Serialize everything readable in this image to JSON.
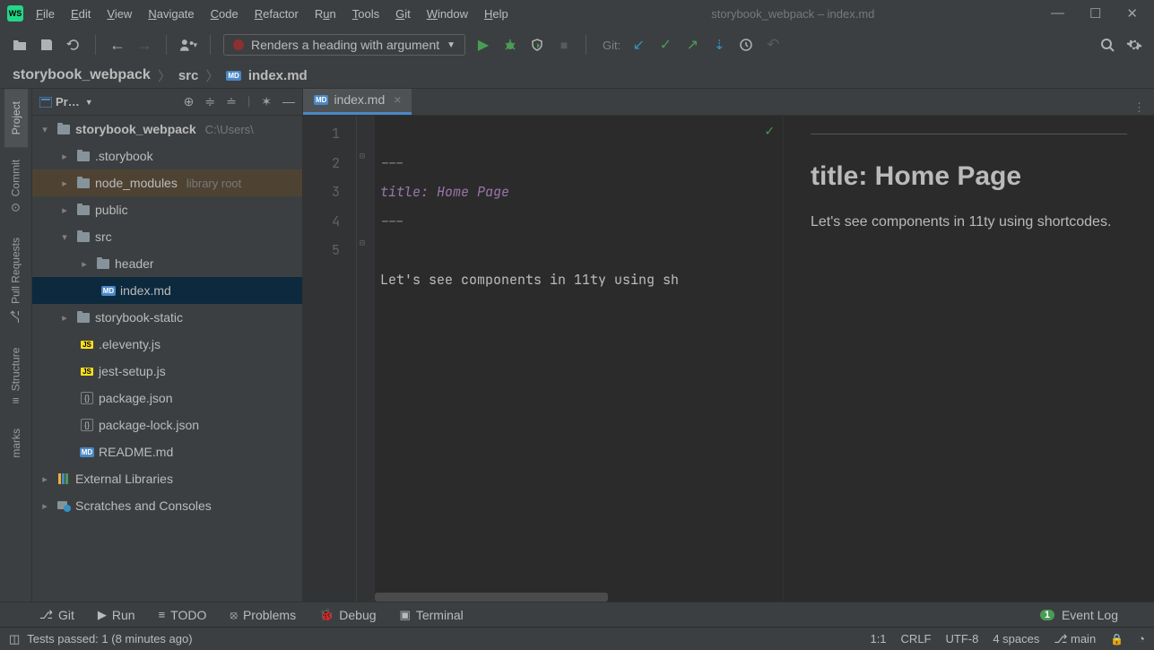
{
  "window": {
    "title": "storybook_webpack – index.md"
  },
  "menu": {
    "file": "File",
    "edit": "Edit",
    "view": "View",
    "navigate": "Navigate",
    "code": "Code",
    "refactor": "Refactor",
    "run": "Run",
    "tools": "Tools",
    "git": "Git",
    "window": "Window",
    "help": "Help"
  },
  "toolbar": {
    "run_config": "Renders a heading with argument",
    "git_label": "Git:"
  },
  "breadcrumb": {
    "project": "storybook_webpack",
    "folder": "src",
    "file": "index.md"
  },
  "sidebarTitle": "Pr…",
  "tree": {
    "root": "storybook_webpack",
    "rootPath": "C:\\Users\\",
    "storybook": ".storybook",
    "node_modules": "node_modules",
    "node_modules_tag": "library root",
    "public": "public",
    "src": "src",
    "header": "header",
    "index_md": "index.md",
    "storybook_static": "storybook-static",
    "eleventy": ".eleventy.js",
    "jest_setup": "jest-setup.js",
    "package": "package.json",
    "package_lock": "package-lock.json",
    "readme": "README.md",
    "external": "External Libraries",
    "scratches": "Scratches and Consoles"
  },
  "tab": {
    "name": "index.md"
  },
  "editor": {
    "line1": "---",
    "line2": "title: Home Page",
    "line3": "---",
    "line4": "",
    "line5": "Let's see components in 11ty using sh"
  },
  "preview": {
    "heading": "title: Home Page",
    "body": "Let's see components in 11ty using shortcodes."
  },
  "toolWindows": {
    "git": "Git",
    "run": "Run",
    "todo": "TODO",
    "problems": "Problems",
    "debug": "Debug",
    "terminal": "Terminal",
    "event_log": "Event Log",
    "event_badge": "1"
  },
  "status": {
    "tests": "Tests passed: 1 (8 minutes ago)",
    "pos": "1:1",
    "eol": "CRLF",
    "enc": "UTF-8",
    "indent": "4 spaces",
    "branch": "main"
  },
  "gutterTabs": {
    "project": "Project",
    "commit": "Commit",
    "pull_requests": "Pull Requests",
    "structure": "Structure",
    "bookmarks": "marks"
  }
}
